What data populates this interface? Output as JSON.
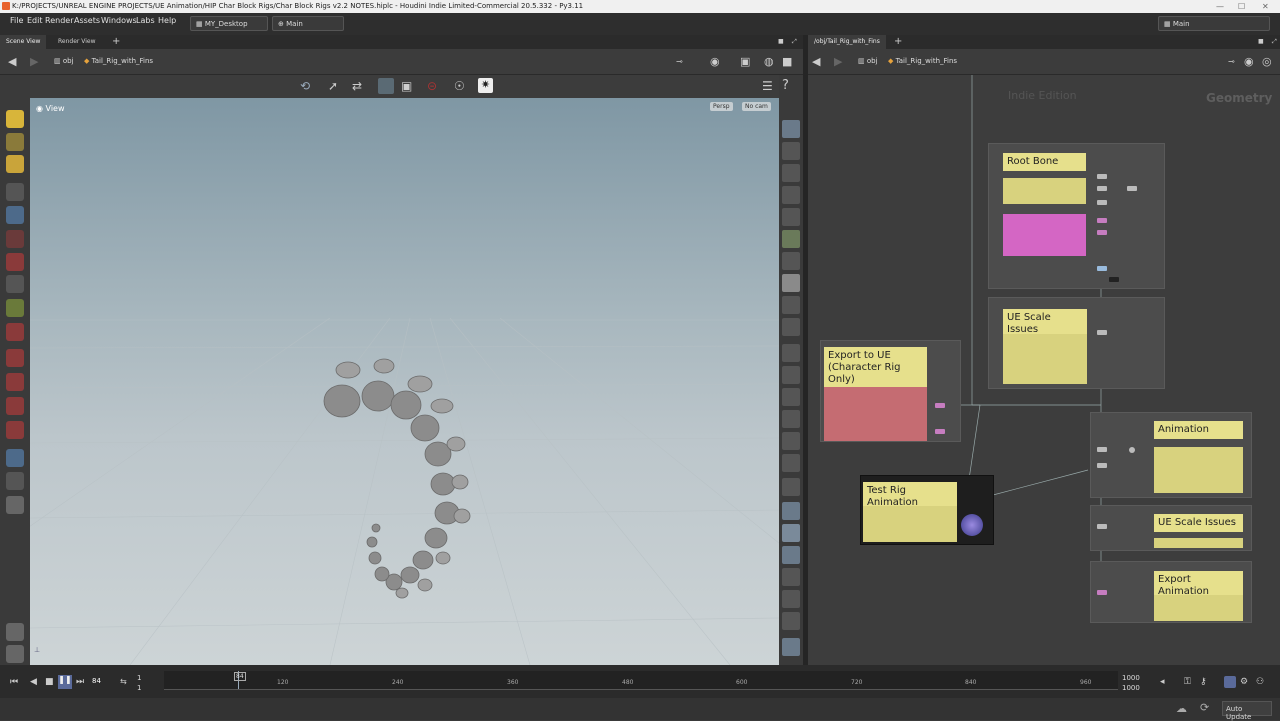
{
  "window": {
    "title": "K:/PROJECTS/UNREAL ENGINE PROJECTS/UE Animation/HIP Char Block Rigs/Char Block Rigs v2.2 NOTES.hiplc - Houdini Indie Limited-Commercial 20.5.332 - Py3.11",
    "desktop": "MY_Desktop",
    "main_label": "Main"
  },
  "menu": [
    "File",
    "Edit",
    "Render",
    "Assets",
    "Windows",
    "Labs",
    "Help"
  ],
  "left_tabs": [
    "Scene View",
    "Render View"
  ],
  "right_tab": "/obj/Tail_Rig_with_Fins",
  "left_path": {
    "context": "obj",
    "node": "Tail_Rig_with_Fins"
  },
  "right_path": {
    "context": "obj",
    "node": "Tail_Rig_with_Fins"
  },
  "viewport": {
    "label": "View",
    "persp": "Persp",
    "cam": "No cam"
  },
  "network": {
    "watermark": "Indie Edition",
    "context_label": "Geometry",
    "notes": [
      {
        "title": "Root Bone"
      },
      {
        "title": "UE Scale Issues"
      },
      {
        "title": "Export to UE (Character Rig Only)"
      },
      {
        "title": "Test Rig Animation"
      },
      {
        "title": "Animation"
      },
      {
        "title": "UE Scale Issues"
      },
      {
        "title": "Export Animation"
      }
    ]
  },
  "timeline": {
    "current_frame": "84",
    "start": "1",
    "start2": "1",
    "end": "1000",
    "end2": "1000",
    "ticks": [
      "84",
      "120",
      "240",
      "360",
      "480",
      "600",
      "720",
      "840",
      "960"
    ],
    "marker": "84"
  },
  "status": {
    "auto_update": "Auto Update"
  },
  "colors": {
    "sticky": "#e6e08c",
    "pink_note": "#d466c4",
    "red_note": "#c56c72",
    "viewport_top": "#7f97a4"
  }
}
